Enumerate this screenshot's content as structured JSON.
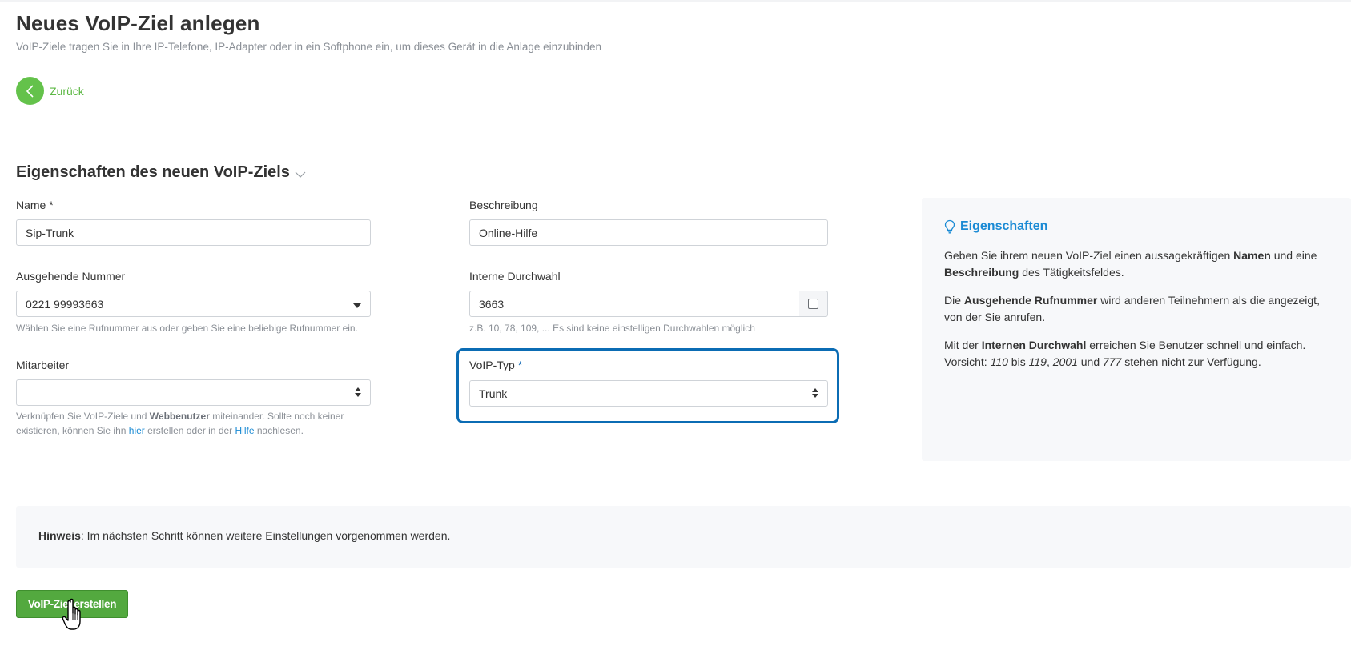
{
  "header": {
    "title": "Neues VoIP-Ziel anlegen",
    "subtitle": "VoIP-Ziele tragen Sie in Ihre IP-Telefone, IP-Adapter oder in ein Softphone ein, um dieses Gerät in die Anlage einzubinden"
  },
  "back": {
    "label": "Zurück"
  },
  "section": {
    "title": "Eigenschaften des neuen VoIP-Ziels"
  },
  "form": {
    "name": {
      "label": "Name",
      "required": "*",
      "value": "Sip-Trunk"
    },
    "beschreibung": {
      "label": "Beschreibung",
      "value": "Online-Hilfe"
    },
    "ausgehende": {
      "label": "Ausgehende Nummer",
      "value": "0221 99993663",
      "help": "Wählen Sie eine Rufnummer aus oder geben Sie eine beliebige Rufnummer ein."
    },
    "durchwahl": {
      "label": "Interne Durchwahl",
      "value": "3663",
      "help": "z.B. 10, 78, 109, ... Es sind keine einstelligen Durchwahlen möglich"
    },
    "mitarbeiter": {
      "label": "Mitarbeiter",
      "value": "",
      "help_part1": "Verknüpfen Sie VoIP-Ziele und ",
      "help_bold": "Webbenutzer",
      "help_part2": " miteinander. Sollte noch keiner",
      "help_part3": "existieren, können Sie ihn ",
      "help_link1": "hier",
      "help_part4": " erstellen oder in der ",
      "help_link2": "Hilfe",
      "help_part5": " nachlesen."
    },
    "voip_typ": {
      "label": "VoIP-Typ",
      "required": "*",
      "value": "Trunk"
    }
  },
  "info": {
    "title": "Eigenschaften",
    "p1_a": "Geben Sie ihrem neuen VoIP-Ziel einen aussagekräftigen ",
    "p1_b": "Namen",
    "p1_c": " und eine",
    "p1_d": "Beschreibung",
    "p1_e": " des Tätigkeitsfeldes.",
    "p2_a": "Die ",
    "p2_b": "Ausgehende Rufnummer",
    "p2_c": " wird anderen Teilnehmern als die angezeigt,",
    "p2_d": "von der Sie anrufen.",
    "p3_a": "Mit der ",
    "p3_b": "Internen Durchwahl",
    "p3_c": " erreichen Sie Benutzer schnell und einfach.",
    "p3_d": "Vorsicht: ",
    "p3_e": "110",
    "p3_f": " bis ",
    "p3_g": "119",
    "p3_h": ", ",
    "p3_i": "2001",
    "p3_j": " und ",
    "p3_k": "777",
    "p3_l": " stehen nicht zur Verfügung."
  },
  "hint": {
    "bold": "Hinweis",
    "text": ": Im nächsten Schritt können weitere Einstellungen vorgenommen werden."
  },
  "submit": {
    "label": "VoIP-Ziel erstellen"
  },
  "colors": {
    "accent_green": "#64c24b",
    "button_green": "#53a93f",
    "focus_blue": "#0b6cb4",
    "link_blue": "#1a8ad4"
  }
}
